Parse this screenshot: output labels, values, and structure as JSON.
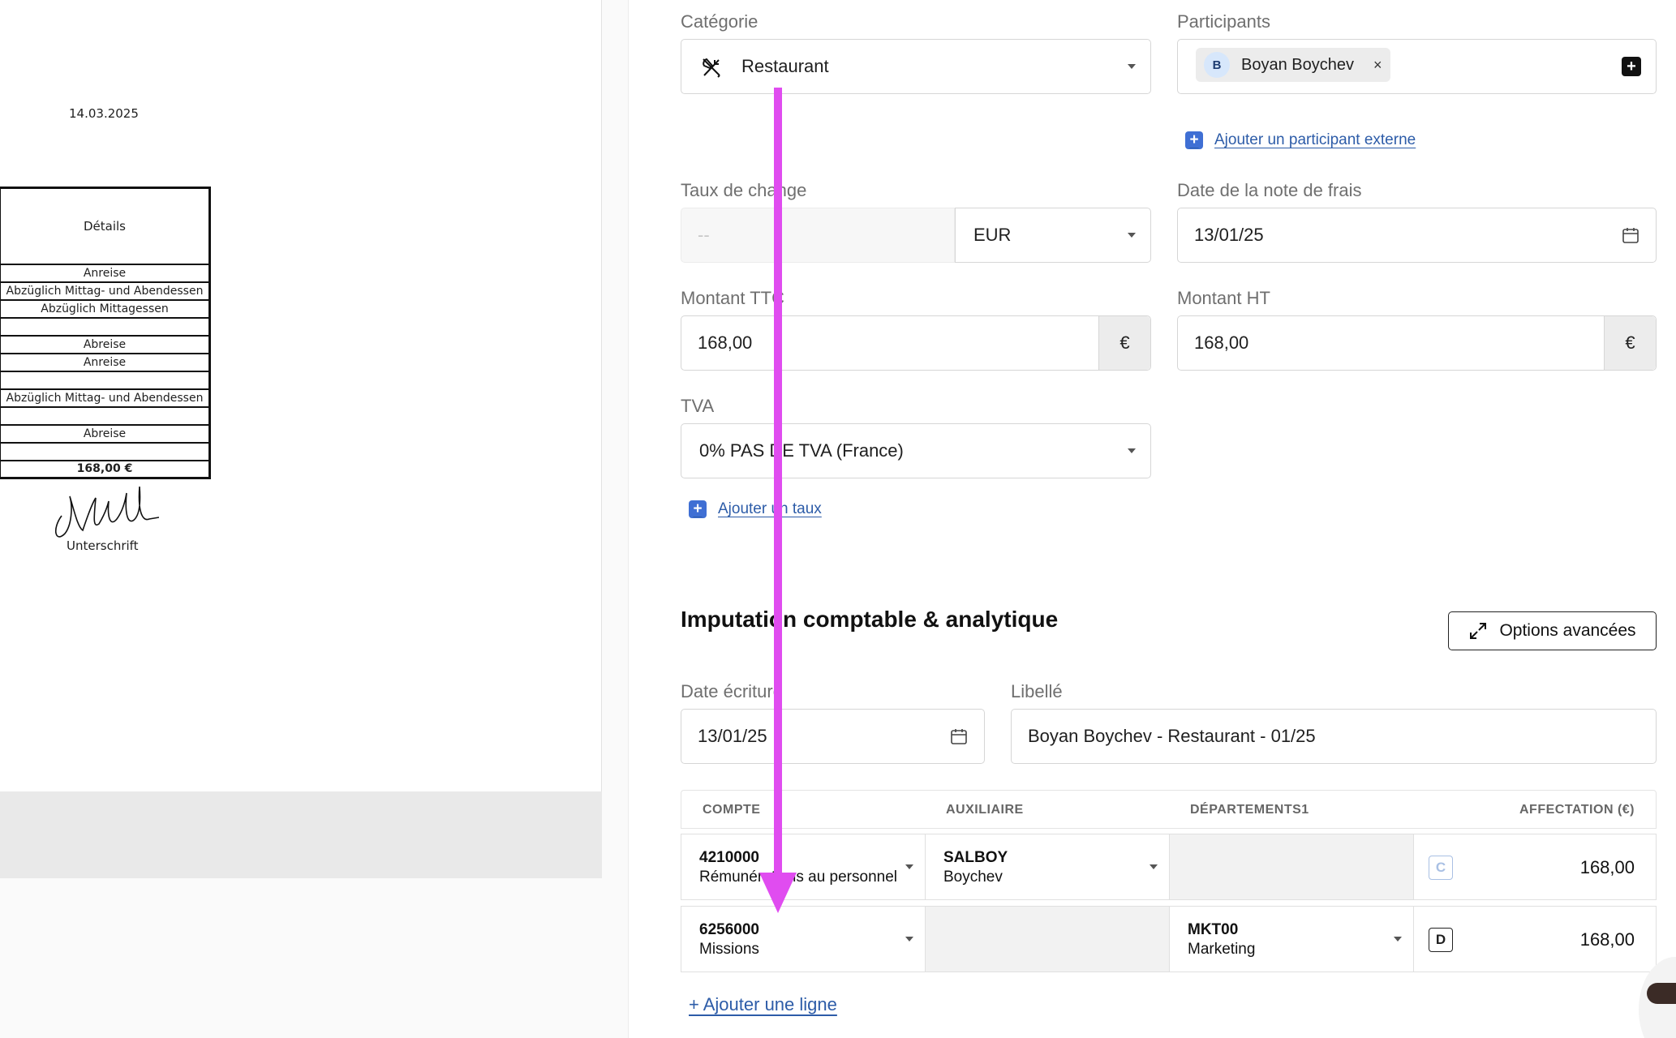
{
  "document_preview": {
    "date": "14.03.2025",
    "table_header": "Détails",
    "rows": [
      "Anreise",
      "Abzüglich Mittag- und Abendessen",
      "Abzüglich Mittagessen",
      "",
      "Abreise",
      "Anreise",
      "",
      "Abzüglich Mittag- und Abendessen",
      "",
      "Abreise",
      ""
    ],
    "total": "168,00 €",
    "signature_label": "Unterschrift"
  },
  "form": {
    "categorie": {
      "label": "Catégorie",
      "value": "Restaurant",
      "icon": "fork-knife-icon"
    },
    "participants": {
      "label": "Participants",
      "chip_initial": "B",
      "chip_name": "Boyan Boychev",
      "remove": "×",
      "add": "+"
    },
    "add_external_participant": "Ajouter un participant externe",
    "taux_de_change": {
      "label": "Taux de change",
      "value": "--",
      "currency": "EUR"
    },
    "date_note": {
      "label": "Date de la note de frais",
      "value": "13/01/25"
    },
    "montant_ttc": {
      "label": "Montant TTC",
      "value": "168,00",
      "suffix": "€"
    },
    "montant_ht": {
      "label": "Montant HT",
      "value": "168,00",
      "suffix": "€"
    },
    "tva": {
      "label": "TVA",
      "value": "0% PAS DE TVA (France)"
    },
    "add_rate": "Ajouter un taux",
    "plus_sign": "+"
  },
  "imputation": {
    "title": "Imputation comptable & analytique",
    "advanced_button": "Options avancées",
    "date_ecriture": {
      "label": "Date écriture",
      "value": "13/01/25"
    },
    "libelle": {
      "label": "Libellé",
      "value": "Boyan Boychev - Restaurant - 01/25"
    },
    "columns": [
      "COMPTE",
      "AUXILIAIRE",
      "DÉPARTEMENTS1",
      "AFFECTATION (€)"
    ],
    "rows": [
      {
        "compte_code": "4210000",
        "compte_name": "Rémunérations au personnel",
        "aux_code": "SALBOY",
        "aux_name": "Boychev",
        "dept_code": "",
        "dept_name": "",
        "type": "C",
        "amount": "168,00"
      },
      {
        "compte_code": "6256000",
        "compte_name": "Missions",
        "aux_code": "",
        "aux_name": "",
        "dept_code": "MKT00",
        "dept_name": "Marketing",
        "type": "D",
        "amount": "168,00"
      }
    ],
    "add_line": "+ Ajouter une ligne"
  },
  "colors": {
    "accent": "#2d5ca8",
    "arrow": "#e04cf0"
  }
}
